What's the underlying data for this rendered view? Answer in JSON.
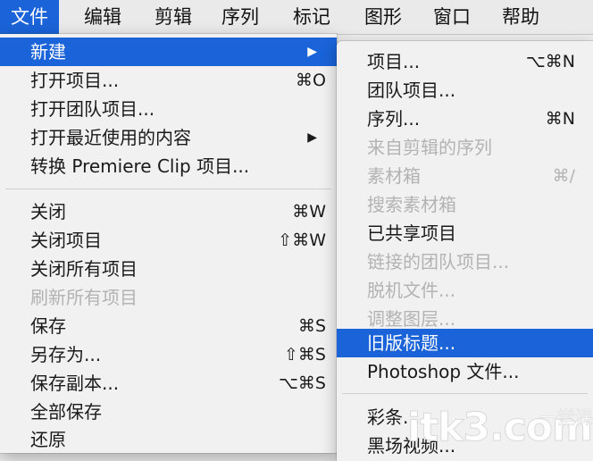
{
  "menubar": {
    "items": [
      {
        "label": "文件"
      },
      {
        "label": "编辑"
      },
      {
        "label": "剪辑"
      },
      {
        "label": "序列"
      },
      {
        "label": "标记"
      },
      {
        "label": "图形"
      },
      {
        "label": "窗口"
      },
      {
        "label": "帮助"
      }
    ],
    "active": "文件"
  },
  "file_menu": {
    "items": [
      {
        "label": "新建",
        "submenu": true,
        "highlighted": true
      },
      {
        "label": "打开项目...",
        "shortcut": "⌘O"
      },
      {
        "label": "打开团队项目..."
      },
      {
        "label": "打开最近使用的内容",
        "submenu": true
      },
      {
        "label": "转换 Premiere Clip 项目..."
      },
      {
        "label": "关闭",
        "shortcut": "⌘W"
      },
      {
        "label": "关闭项目",
        "shortcut": "⇧⌘W"
      },
      {
        "label": "关闭所有项目"
      },
      {
        "label": "刷新所有项目",
        "disabled": true
      },
      {
        "label": "保存",
        "shortcut": "⌘S"
      },
      {
        "label": "另存为...",
        "shortcut": "⇧⌘S"
      },
      {
        "label": "保存副本...",
        "shortcut": "⌥⌘S"
      },
      {
        "label": "全部保存"
      },
      {
        "label": "还原"
      }
    ],
    "submenu_arrow": "▶"
  },
  "new_submenu": {
    "items": [
      {
        "label": "项目...",
        "shortcut": "⌥⌘N"
      },
      {
        "label": "团队项目..."
      },
      {
        "label": "序列...",
        "shortcut": "⌘N"
      },
      {
        "label": "来自剪辑的序列",
        "disabled": true
      },
      {
        "label": "素材箱",
        "shortcut": "⌘/",
        "disabled": true
      },
      {
        "label": "搜索素材箱",
        "disabled": true
      },
      {
        "label": "已共享项目"
      },
      {
        "label": "链接的团队项目...",
        "disabled": true
      },
      {
        "label": "脱机文件...",
        "disabled": true
      },
      {
        "label": "调整图层...",
        "disabled": true
      },
      {
        "label": "旧版标题...",
        "highlighted": true
      },
      {
        "label": "Photoshop 文件..."
      },
      {
        "label": "彩条..."
      },
      {
        "label": "黑场视频..."
      }
    ]
  },
  "watermark": {
    "main": "itk3.com",
    "tag": "一堂课"
  },
  "colors": {
    "highlight": "#1a63d8",
    "disabled": "#b3b3b3",
    "menu_bg": "#f1f1f1"
  }
}
